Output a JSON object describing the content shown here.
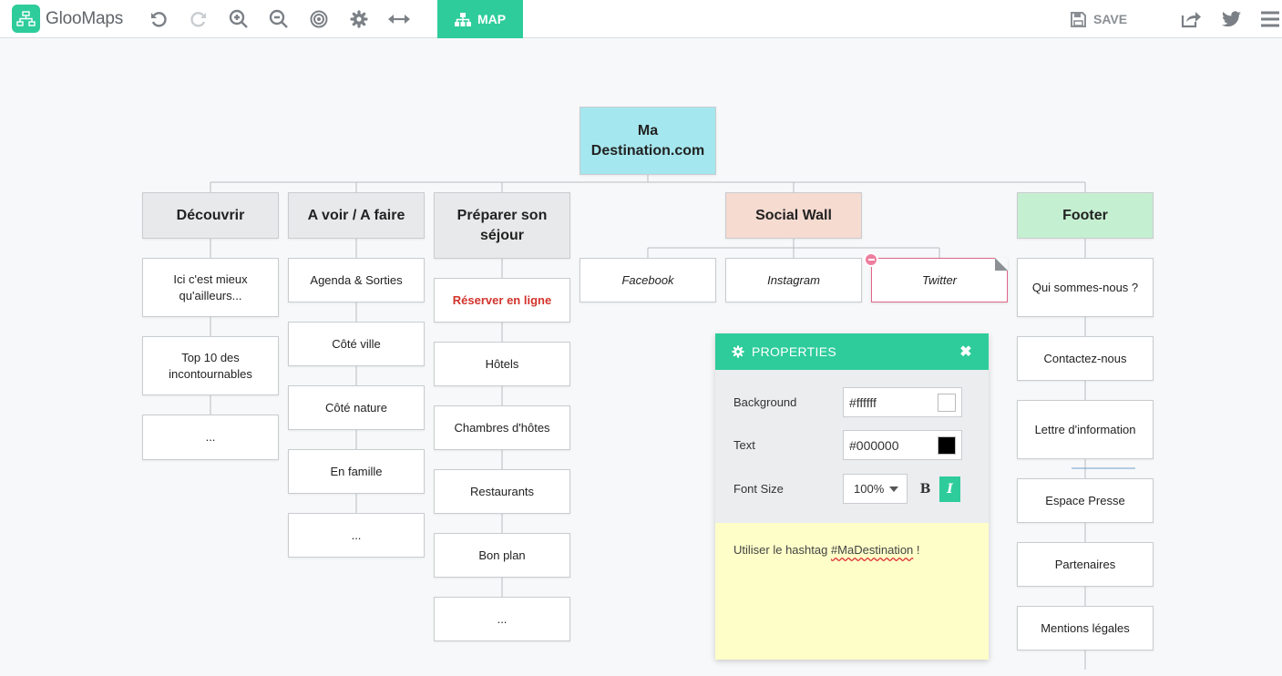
{
  "app": {
    "name": "GlooMaps"
  },
  "toolbar": {
    "undo": "undo-icon",
    "redo": "redo-icon",
    "zoom_in": "zoom-in-icon",
    "zoom_out": "zoom-out-icon",
    "center": "target-icon",
    "settings": "gear-icon",
    "width": "arrows-horizontal-icon",
    "map_label": "MAP",
    "save_label": "SAVE",
    "share": "share-icon",
    "twitter": "twitter-icon",
    "menu": "menu-icon"
  },
  "colors": {
    "accent": "#2ecc9a",
    "root": "#a5e7ee",
    "social": "#f6dbd1",
    "footer": "#c5efd1",
    "note": "#fefec8",
    "selected_border": "#e0668a"
  },
  "map": {
    "root": "Ma Destination.com",
    "columns": [
      {
        "title": "Découvrir",
        "items": [
          "Ici c'est mieux qu'ailleurs...",
          "Top 10 des incontournables",
          "..."
        ]
      },
      {
        "title": "A voir / A faire",
        "items": [
          "Agenda & Sorties",
          "Côté ville",
          "Côté nature",
          "En famille",
          "..."
        ]
      },
      {
        "title": "Préparer son séjour",
        "items": [
          "Réserver en ligne",
          "Hôtels",
          "Chambres d'hôtes",
          "Restaurants",
          "Bon plan",
          "..."
        ]
      },
      {
        "title": "Social Wall",
        "items": [
          "Facebook",
          "Instagram",
          "Twitter"
        ]
      },
      {
        "title": "Footer",
        "items": [
          "Qui sommes-nous ?",
          "Contactez-nous",
          "Lettre d'information",
          "Espace Presse",
          "Partenaires",
          "Mentions légales"
        ]
      }
    ]
  },
  "properties": {
    "title": "PROPERTIES",
    "background_label": "Background",
    "background_value": "#ffffff",
    "text_label": "Text",
    "text_value": "#000000",
    "font_size_label": "Font Size",
    "font_size_value": "100%",
    "bold_label": "B",
    "italic_label": "I",
    "note_prefix": "Utiliser le hashtag ",
    "note_tag": "#MaDestination",
    "note_suffix": " !"
  }
}
